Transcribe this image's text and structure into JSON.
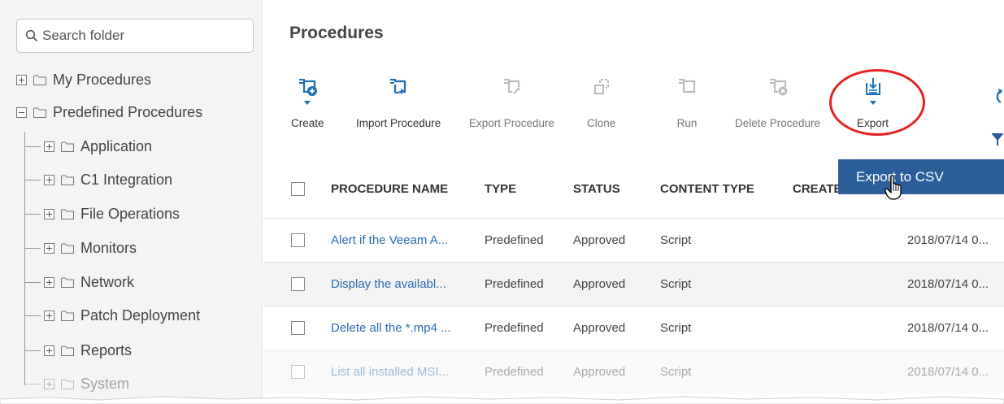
{
  "sidebar": {
    "search_placeholder": "Search folder",
    "tree": {
      "my_procedures": "My Procedures",
      "predefined_procedures": "Predefined Procedures",
      "children": [
        "Application",
        "C1 Integration",
        "File Operations",
        "Monitors",
        "Network",
        "Patch Deployment",
        "Reports",
        "System"
      ]
    }
  },
  "main": {
    "title": "Procedures",
    "toolbar": {
      "create": "Create",
      "import_procedure": "Import Procedure",
      "export_procedure": "Export Procedure",
      "clone": "Clone",
      "run": "Run",
      "delete_procedure": "Delete Procedure",
      "export": "Export"
    },
    "export_menu": {
      "export_to_csv": "Export to CSV"
    },
    "table": {
      "headers": [
        "PROCEDURE NAME",
        "TYPE",
        "STATUS",
        "CONTENT TYPE",
        "CREATE"
      ],
      "rows": [
        {
          "name": "Alert if the Veeam A...",
          "type": "Predefined",
          "status": "Approved",
          "content_type": "Script",
          "created": "2018/07/14 0..."
        },
        {
          "name": "Display the availabl...",
          "type": "Predefined",
          "status": "Approved",
          "content_type": "Script",
          "created": "2018/07/14 0..."
        },
        {
          "name": "Delete all the *.mp4 ...",
          "type": "Predefined",
          "status": "Approved",
          "content_type": "Script",
          "created": "2018/07/14 0..."
        },
        {
          "name": "List all installed MSI...",
          "type": "Predefined",
          "status": "Approved",
          "content_type": "Script",
          "created": "2018/07/14 0..."
        }
      ]
    }
  },
  "colors": {
    "accent_blue": "#1d6fb8",
    "menu_blue": "#2c5f9a",
    "highlight_red": "#e42424",
    "link_blue": "#2b6cb0"
  }
}
